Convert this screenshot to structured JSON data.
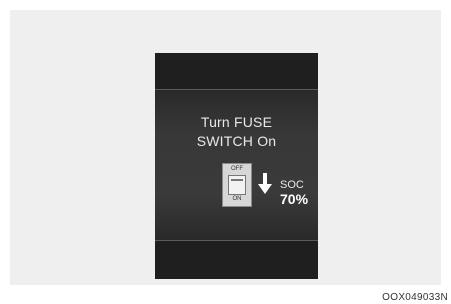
{
  "display": {
    "message_line1": "Turn FUSE",
    "message_line2": "SWITCH On",
    "switch_off_label": "OFF",
    "switch_on_label": "ON",
    "soc_label": "SOC",
    "soc_value": "70%"
  },
  "figure_code": "OOX049033N",
  "colors": {
    "panel_background": "#efefef",
    "display_background": "#1f1f1f",
    "text": "#e8e8e8"
  },
  "icons": [
    "fuse-switch-icon",
    "arrow-down-icon"
  ]
}
